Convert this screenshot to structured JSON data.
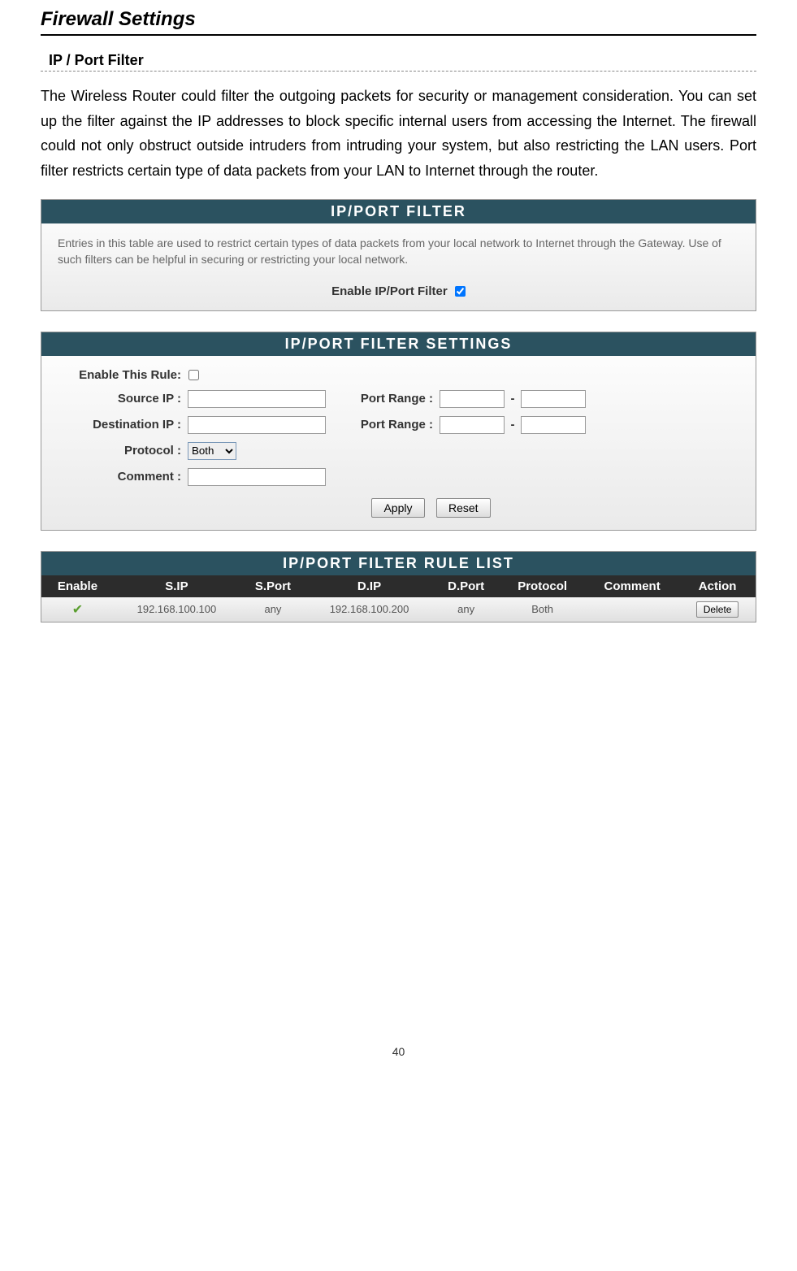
{
  "heading": "Firewall Settings",
  "section_title": "IP / Port Filter",
  "body_text": "The Wireless Router could filter the outgoing packets for security or management consideration. You can set up the filter against the IP addresses to block specific internal users from accessing the Internet. The firewall could not only obstruct outside intruders from intruding your system, but also restricting the LAN users. Port filter restricts certain type of data packets from your LAN to Internet through the router.",
  "panel1": {
    "title": "IP/PORT FILTER",
    "description": "Entries in this table are used to restrict certain types of data packets from your local network to Internet through the Gateway. Use of such filters can be helpful in securing or restricting your local network.",
    "enable_label": "Enable IP/Port Filter"
  },
  "panel2": {
    "title": "IP/PORT FILTER SETTINGS",
    "enable_rule": "Enable This Rule:",
    "source_ip": "Source IP :",
    "destination_ip": "Destination IP :",
    "protocol": "Protocol :",
    "comment": "Comment :",
    "port_range": "Port Range :",
    "protocol_option": "Both",
    "apply": "Apply",
    "reset": "Reset"
  },
  "panel3": {
    "title": "IP/PORT FILTER RULE LIST",
    "columns": {
      "enable": "Enable",
      "sip": "S.IP",
      "sport": "S.Port",
      "dip": "D.IP",
      "dport": "D.Port",
      "protocol": "Protocol",
      "comment": "Comment",
      "action": "Action"
    },
    "row": {
      "sip": "192.168.100.100",
      "sport": "any",
      "dip": "192.168.100.200",
      "dport": "any",
      "protocol": "Both",
      "comment": "",
      "delete": "Delete"
    }
  },
  "page_number": "40"
}
